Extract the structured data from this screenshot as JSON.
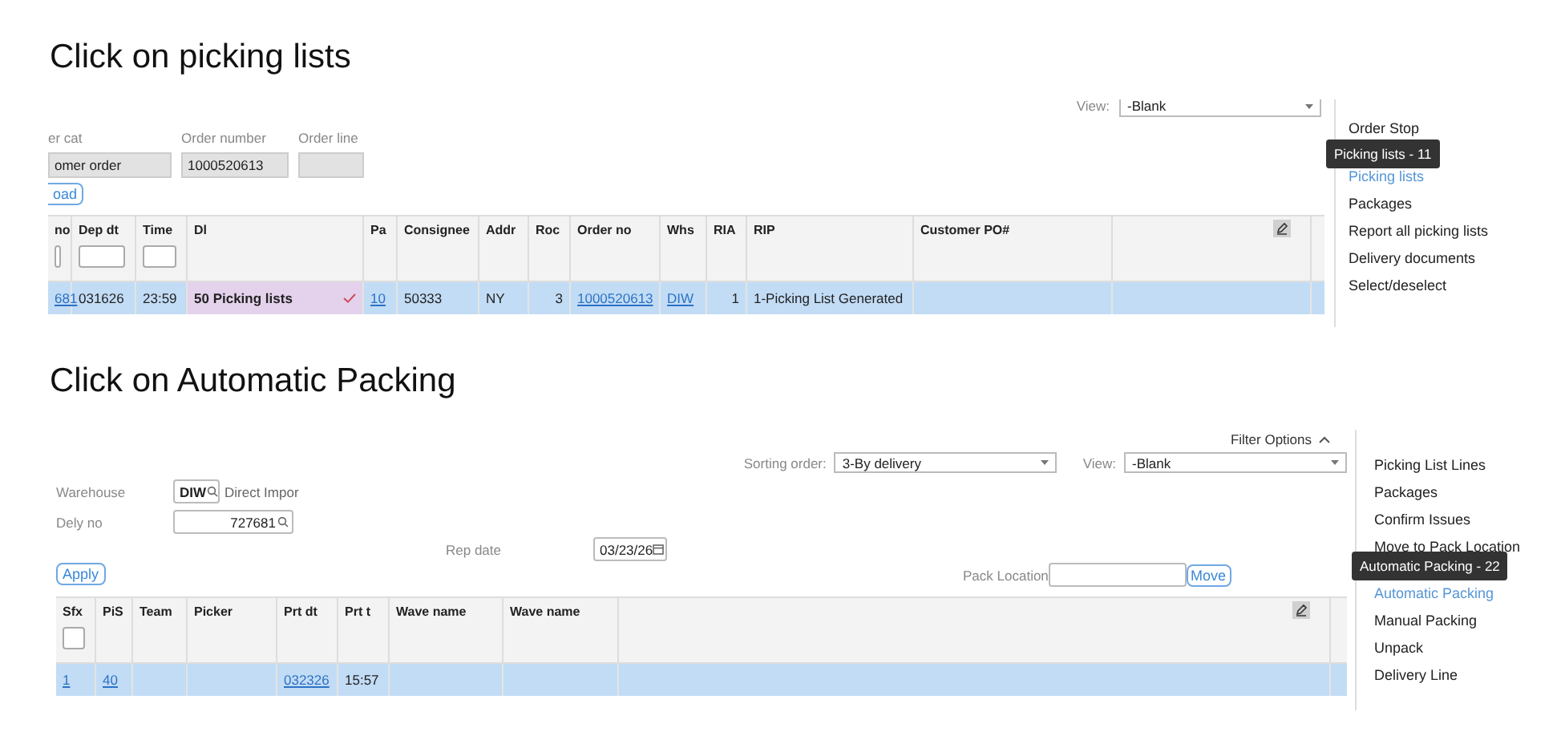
{
  "steps": [
    {
      "kind": "orders",
      "heading": "Click on picking lists",
      "view": {
        "label": "View:",
        "value": "-Blank"
      },
      "fields": [
        {
          "label": "er cat",
          "value": "omer order"
        },
        {
          "label": "Order number",
          "value": "1000520613"
        },
        {
          "label": "Order line"
        }
      ],
      "action_button": "oad",
      "table": {
        "columns": [
          {
            "label": "no",
            "filter": true
          },
          {
            "label": "Dep dt",
            "filter": true
          },
          {
            "label": "Time",
            "filter": true
          },
          {
            "label": "Dl",
            "filter": false
          },
          {
            "label": "Pa",
            "filter": false
          },
          {
            "label": "Consignee",
            "filter": false
          },
          {
            "label": "Addr",
            "filter": false
          },
          {
            "label": "Roc",
            "filter": false
          },
          {
            "label": "Order no",
            "filter": false
          },
          {
            "label": "Whs",
            "filter": false
          },
          {
            "label": "RIA",
            "filter": false
          },
          {
            "label": "RIP",
            "filter": false
          },
          {
            "label": "Customer PO#",
            "filter": false
          },
          {
            "filter": false
          }
        ],
        "rows": [
          {
            "selected": true,
            "cells": [
              {
                "text": "681",
                "kind": "link"
              },
              {
                "text": "031626",
                "kind": "text"
              },
              {
                "text": "23:59",
                "kind": "text"
              },
              {
                "text": "50 Picking lists",
                "kind": "status",
                "checked": true
              },
              {
                "text": "10",
                "kind": "link"
              },
              {
                "text": "50333",
                "kind": "text"
              },
              {
                "text": "NY",
                "kind": "text"
              },
              {
                "text": "3",
                "kind": "number"
              },
              {
                "text": "1000520613",
                "kind": "link"
              },
              {
                "text": "DIW",
                "kind": "link"
              },
              {
                "text": "1",
                "kind": "number"
              },
              {
                "text": "1-Picking List Generated",
                "kind": "text"
              },
              null,
              null
            ]
          }
        ]
      },
      "menu": [
        {
          "label": "Order Stop",
          "selected": false
        },
        {
          "label": "Picking lists",
          "selected": true
        },
        {
          "label": "Packages",
          "selected": false
        },
        {
          "label": "Report all picking lists",
          "selected": false
        },
        {
          "label": "Delivery documents",
          "selected": false
        },
        {
          "label": "Select/deselect",
          "selected": false
        }
      ],
      "tooltip": "Picking lists - 11"
    },
    {
      "kind": "packing",
      "heading": "Click on Automatic Packing",
      "filter_toggle": "Filter Options",
      "sorting": {
        "label": "Sorting order:",
        "value": "3-By delivery"
      },
      "view": {
        "label": "View:",
        "value": "-Blank"
      },
      "warehouse": {
        "label": "Warehouse",
        "value": "DIW",
        "description": "Direct Impor"
      },
      "delivery": {
        "label": "Dely no",
        "value": "727681"
      },
      "rep_date": {
        "label": "Rep date",
        "value": "03/23/26"
      },
      "action_button": "Apply",
      "pack_location": {
        "label": "Pack Location",
        "button": "Move"
      },
      "table": {
        "columns": [
          {
            "label": "Sfx",
            "filter": true
          },
          {
            "label": "PiS",
            "filter": false
          },
          {
            "label": "Team",
            "filter": false
          },
          {
            "label": "Picker",
            "filter": false
          },
          {
            "label": "Prt dt",
            "filter": false
          },
          {
            "label": "Prt t",
            "filter": false
          },
          {
            "label": "Wave name",
            "filter": false
          },
          {
            "label": "Wave name",
            "filter": false
          },
          {
            "filter": false
          }
        ],
        "rows": [
          {
            "selected": true,
            "cells": [
              {
                "text": "1",
                "kind": "link"
              },
              {
                "text": "40",
                "kind": "link"
              },
              null,
              null,
              {
                "text": "032326",
                "kind": "link"
              },
              {
                "text": "15:57",
                "kind": "text"
              },
              null,
              null,
              null
            ]
          }
        ]
      },
      "menu": [
        {
          "label": "Picking List Lines",
          "selected": false
        },
        {
          "label": "Packages",
          "selected": false
        },
        {
          "label": "Confirm Issues",
          "selected": false
        },
        {
          "label": "Move to Pack Location",
          "selected": false
        },
        {
          "label": "Automatic Packing",
          "selected": true
        },
        {
          "label": "Manual Packing",
          "selected": false
        },
        {
          "label": "Unpack",
          "selected": false
        },
        {
          "label": "Delivery Line",
          "selected": false
        }
      ],
      "tooltip": "Automatic Packing - 22"
    }
  ]
}
